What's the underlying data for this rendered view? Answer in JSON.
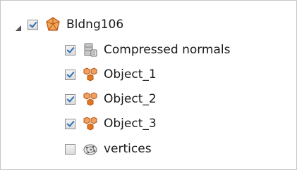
{
  "tree": {
    "root": {
      "label": "Bldng106",
      "checked": true,
      "expanded": true,
      "icon": "building-polygon-icon"
    },
    "children": [
      {
        "label": "Compressed normals",
        "checked": true,
        "icon": "database-stack-icon"
      },
      {
        "label": "Object_1",
        "checked": true,
        "icon": "object-cluster-icon"
      },
      {
        "label": "Object_2",
        "checked": true,
        "icon": "object-cluster-icon"
      },
      {
        "label": "Object_3",
        "checked": true,
        "icon": "object-cluster-icon"
      },
      {
        "label": "vertices",
        "checked": false,
        "icon": "vertices-cloud-icon"
      }
    ]
  },
  "colors": {
    "accent_orange": "#e2771e",
    "check_blue": "#2d6fb5",
    "border_gray": "#c6c6c6"
  }
}
